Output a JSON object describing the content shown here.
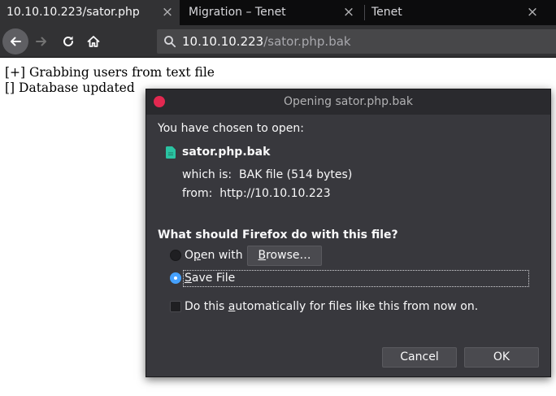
{
  "tabs": [
    {
      "title": "10.10.10.223/sator.php",
      "close": "×"
    },
    {
      "title": "Migration – Tenet",
      "close": "×"
    },
    {
      "title": "Tenet",
      "close": "×"
    }
  ],
  "urlbar": {
    "host": "10.10.10.223",
    "path": "/sator.php.bak"
  },
  "page": {
    "lines": [
      "[+] Grabbing users from text file",
      "[] Database updated"
    ]
  },
  "dialog": {
    "title": "Opening sator.php.bak",
    "chosen_label": "You have chosen to open:",
    "filename": "sator.php.bak",
    "which_is_label": "which is:",
    "which_is_value": "BAK file (514 bytes)",
    "from_label": "from:",
    "from_value": "http://10.10.10.223",
    "question": "What should Firefox do with this file?",
    "open_with": {
      "before": "O",
      "accel": "p",
      "after": "en with"
    },
    "browse_button": {
      "accel": "B",
      "after": "rowse…"
    },
    "save_file": {
      "accel": "S",
      "after": "ave File"
    },
    "auto_checkbox": {
      "before": "Do this ",
      "accel": "a",
      "after": "utomatically for files like this from now on."
    },
    "cancel_button": "Cancel",
    "ok_button": "OK",
    "selected_option": "save_file",
    "auto_checked": false
  },
  "colors": {
    "tab_strip": "#0c0c0d",
    "toolbar": "#323234",
    "dialog_bg": "#38383d",
    "accent": "#45a1ff",
    "close_dot": "#e22850",
    "file_icon": "#2ac3a2"
  },
  "icons": {
    "back": "back-arrow-icon",
    "forward": "forward-arrow-icon",
    "reload": "reload-icon",
    "home": "home-icon",
    "search": "search-icon",
    "file": "file-icon"
  }
}
